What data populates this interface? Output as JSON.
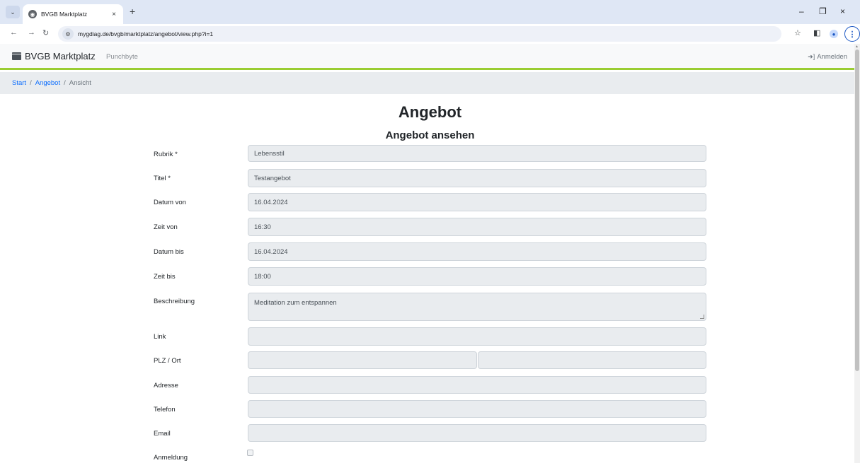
{
  "browser": {
    "tab_title": "BVGB Marktplatz",
    "tab_close": "×",
    "new_tab": "+",
    "url": "mygdiag.de/bvgb/marktplatz/angebot/view.php?i=1",
    "controls": {
      "minimize": "–",
      "restore": "❐",
      "close": "×"
    }
  },
  "navbar": {
    "brand": "BVGB Marktplatz",
    "link": "Punchbyte",
    "login": "Anmelden",
    "accent_color": "#9acd32"
  },
  "breadcrumb": {
    "items": [
      "Start",
      "Angebot"
    ],
    "separator": "/",
    "active": "Ansicht"
  },
  "main": {
    "title": "Angebot",
    "subtitle": "Angebot ansehen"
  },
  "form": {
    "rubrik": {
      "label": "Rubrik *",
      "value": "Lebensstil"
    },
    "titel": {
      "label": "Titel *",
      "value": "Testangebot"
    },
    "datum_von": {
      "label": "Datum von",
      "value": "16.04.2024"
    },
    "zeit_von": {
      "label": "Zeit von",
      "value": "16:30"
    },
    "datum_bis": {
      "label": "Datum bis",
      "value": "16.04.2024"
    },
    "zeit_bis": {
      "label": "Zeit bis",
      "value": "18:00"
    },
    "beschreibung": {
      "label": "Beschreibung",
      "value": "Meditation zum entspannen"
    },
    "link": {
      "label": "Link",
      "value": ""
    },
    "plz_ort": {
      "label": "PLZ / Ort",
      "plz": "",
      "ort": ""
    },
    "adresse": {
      "label": "Adresse",
      "value": ""
    },
    "telefon": {
      "label": "Telefon",
      "value": ""
    },
    "email": {
      "label": "Email",
      "value": ""
    },
    "anmeldung": {
      "label": "Anmeldung",
      "checked": false
    }
  }
}
